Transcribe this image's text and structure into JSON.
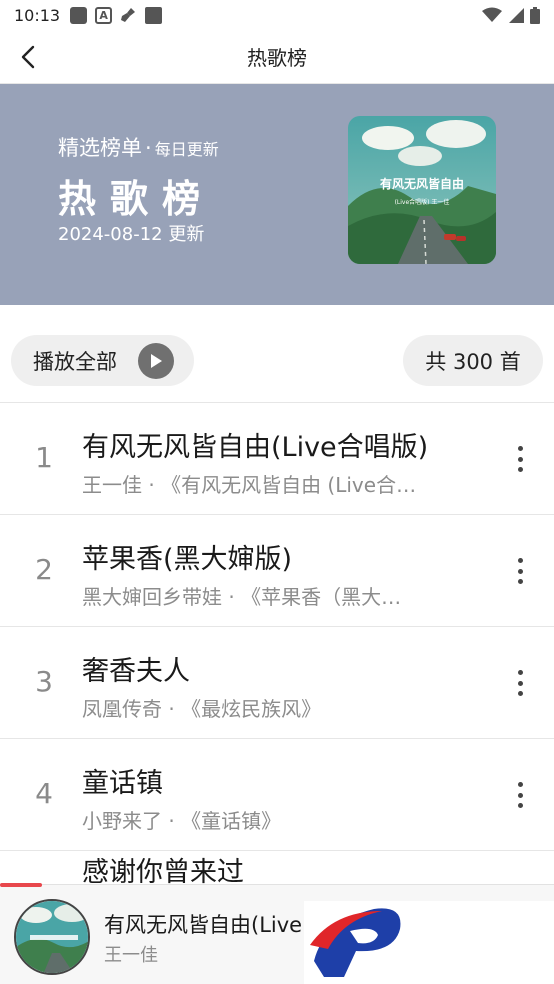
{
  "status_bar": {
    "time": "10:13",
    "icons": [
      "message-icon",
      "a-icon",
      "broom-icon",
      "square-icon",
      "wifi-icon",
      "signal-icon",
      "battery-icon"
    ]
  },
  "header": {
    "title": "热歌榜",
    "back_icon": "chevron-left-icon"
  },
  "banner": {
    "subtitle": "精选榜单",
    "dot": "·",
    "subtitle_small": "每日更新",
    "title": "热歌榜",
    "date": "2024-08-12 更新",
    "cover_text": "有风无风皆自由",
    "cover_subtext": "(Live合唱版) 王一佳",
    "background": "#98a2b8"
  },
  "actions": {
    "play_all_label": "播放全部",
    "total_label": "共 300 首"
  },
  "songs": [
    {
      "index": "1",
      "title": "有风无风皆自由(Live合唱版)",
      "meta": "王一佳 · 《有风无风皆自由 (Live合…"
    },
    {
      "index": "2",
      "title": "苹果香(黑大婶版)",
      "meta": "黑大婶回乡带娃 · 《苹果香（黑大…"
    },
    {
      "index": "3",
      "title": "奢香夫人",
      "meta": "凤凰传奇 · 《最炫民族风》"
    },
    {
      "index": "4",
      "title": "童话镇",
      "meta": "小野来了 · 《童话镇》"
    }
  ],
  "partial_song_title": "感谢你曾来过",
  "player": {
    "title": "有风无风皆自由(Live",
    "artist": "王一佳",
    "progress": 0.076,
    "accent": "#e8474c"
  }
}
